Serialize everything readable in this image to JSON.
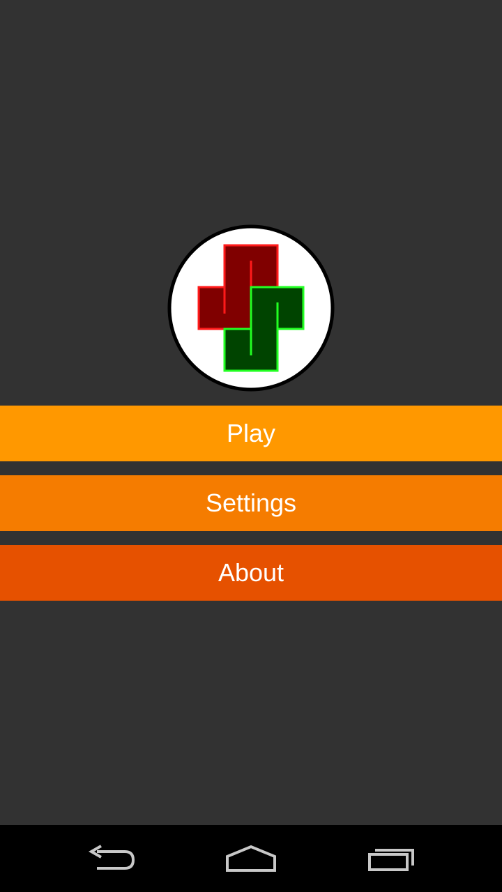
{
  "colors": {
    "background": "#323232",
    "play_button": "#FF9800",
    "settings_button": "#F57C00",
    "about_button": "#E65100",
    "nav_bar": "#000000",
    "logo_red_fill": "#800000",
    "logo_red_stroke": "#FF1A1A",
    "logo_green_fill": "#004400",
    "logo_green_stroke": "#22FF22"
  },
  "logo": {
    "icon": "app-logo-icon"
  },
  "menu": {
    "play_label": "Play",
    "settings_label": "Settings",
    "about_label": "About"
  },
  "navigation_bar": {
    "back_icon": "back-icon",
    "home_icon": "home-icon",
    "recents_icon": "recent-apps-icon"
  }
}
